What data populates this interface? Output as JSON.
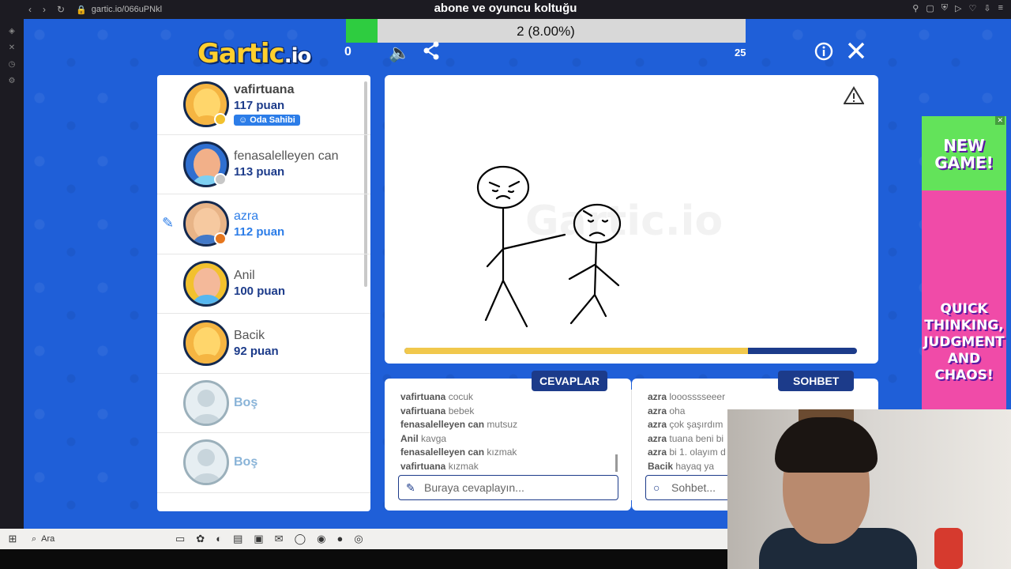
{
  "browser": {
    "url": "gartic.io/066uPNkl",
    "stream_title": "abone ve oyuncu koltuğu"
  },
  "header": {
    "logo_text": "Gartic",
    "logo_suffix": ".io",
    "score": "0",
    "progress_label": "2 (8.00%)",
    "progress_fraction": 0.08,
    "timer": "25"
  },
  "players": [
    {
      "name": "vafirtuana",
      "points": "117 puan",
      "badge": "Oda Sahibi",
      "status_color": "#f2c12e"
    },
    {
      "name": "fenasalelleyen can",
      "points": "113 puan",
      "status_color": "#c7c7c7"
    },
    {
      "name": "azra",
      "points": "112 puan",
      "status_color": "#e6761d",
      "drawing": true
    },
    {
      "name": "Anil",
      "points": "100 puan"
    },
    {
      "name": "Bacik",
      "points": "92 puan"
    },
    {
      "name": "Boş"
    },
    {
      "name": "Boş"
    }
  ],
  "canvas": {
    "watermark": "Gartic.io",
    "time_fraction": 0.76
  },
  "answers": {
    "tab": "CEVAPLAR",
    "input_placeholder": "Buraya cevaplayın...",
    "messages": [
      {
        "user": "vafirtuana",
        "text": "cocuk"
      },
      {
        "user": "vafirtuana",
        "text": "bebek"
      },
      {
        "user": "fenasalelleyen can",
        "text": "mutsuz"
      },
      {
        "user": "Anil",
        "text": "kavga"
      },
      {
        "user": "fenasalelleyen can",
        "text": "kızmak"
      },
      {
        "user": "vafirtuana",
        "text": "kızmak"
      }
    ]
  },
  "chat": {
    "tab": "SOHBET",
    "input_placeholder": "Sohbet...",
    "messages": [
      {
        "user": "azra",
        "text": "looosssseeer"
      },
      {
        "user": "azra",
        "text": "oha"
      },
      {
        "user": "azra",
        "text": "çok şaşırdım"
      },
      {
        "user": "azra",
        "text": "tuana beni bi"
      },
      {
        "user": "azra",
        "text": "bi 1. olayım d"
      },
      {
        "user": "Bacik",
        "text": "hayaq ya"
      }
    ]
  },
  "ad": {
    "top_text": "NEW GAME!",
    "bottom_text": "QUICK THINKING, JUDGMENT AND CHAOS!"
  },
  "taskbar": {
    "search_label": "Ara"
  }
}
